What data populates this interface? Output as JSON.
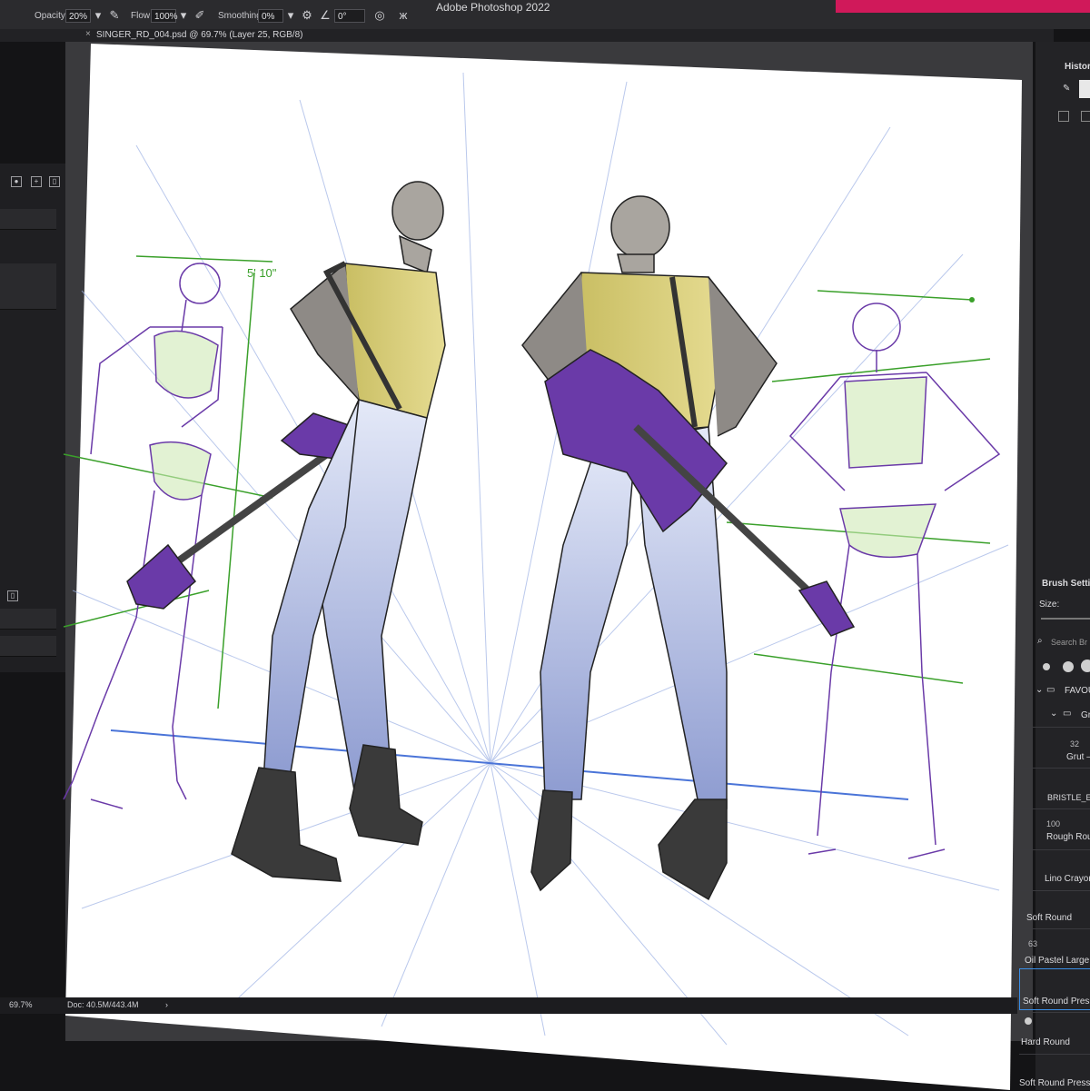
{
  "app": {
    "title": "Adobe Photoshop 2022"
  },
  "options_bar": {
    "opacity_label": "Opacity:",
    "opacity_value": "20%",
    "flow_label": "Flow:",
    "flow_value": "100%",
    "smoothing_label": "Smoothing:",
    "smoothing_value": "0%",
    "angle_value": "0°"
  },
  "document_tab": {
    "title": "SINGER_RD_004.psd @ 69.7% (Layer 25, RGB/8)"
  },
  "canvas": {
    "height_annotation": "5' 10\""
  },
  "right_panel": {
    "history_label": "Histor",
    "brush_settings_label": "Brush Settin",
    "size_label": "Size:",
    "search_placeholder": "Search Br",
    "folder_favourites": "FAVOU",
    "folder_group": "Gr",
    "brushes": [
      {
        "size": "32",
        "name": "Grut –"
      },
      {
        "size": "",
        "name": "BRISTLE_E"
      },
      {
        "size": "100",
        "name": "Rough Rour"
      },
      {
        "size": "",
        "name": "Lino Crayor"
      },
      {
        "size": "",
        "name": "Soft Round"
      },
      {
        "size": "63",
        "name": "Oil Pastel Large"
      },
      {
        "size": "",
        "name": "Soft Round Press"
      },
      {
        "size": "",
        "name": "Hard Round"
      },
      {
        "size": "",
        "name": "Soft Round Press"
      }
    ]
  },
  "status_bar": {
    "zoom": "69.7%",
    "doc_size": "Doc: 40.5M/443.4M",
    "arrow": "›"
  },
  "colors": {
    "accent": "#d0195a",
    "figure_purple": "#6a3aa8",
    "sketch_green": "#3aa02a",
    "shirt": "#d9cc74",
    "jeans": "#b8c4e8"
  }
}
